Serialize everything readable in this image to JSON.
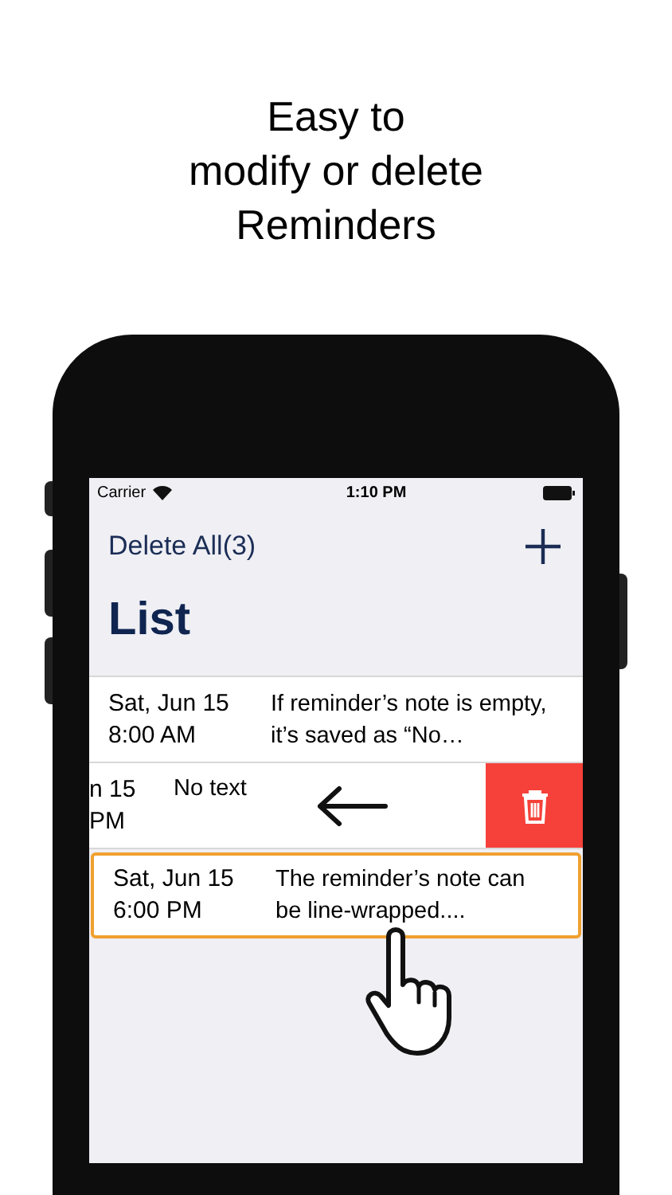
{
  "headline": [
    "Easy to",
    "modify or delete",
    "Reminders"
  ],
  "status_bar": {
    "carrier": "Carrier",
    "time": "1:10 PM"
  },
  "nav": {
    "left_button": "Delete All(3)",
    "title": "List"
  },
  "rows": [
    {
      "kind": "normal",
      "date": "Sat, Jun 15",
      "time": "8:00 AM",
      "note": "If reminder’s note is empty, it’s saved as “No…",
      "highlighted": false
    },
    {
      "kind": "swiped",
      "date": "n 15",
      "time": "PM",
      "note": "No text",
      "highlighted": false
    },
    {
      "kind": "normal",
      "date": "Sat, Jun 15",
      "time": "6:00 PM",
      "note": "The reminder’s note can be line-wrapped....",
      "highlighted": true
    }
  ]
}
